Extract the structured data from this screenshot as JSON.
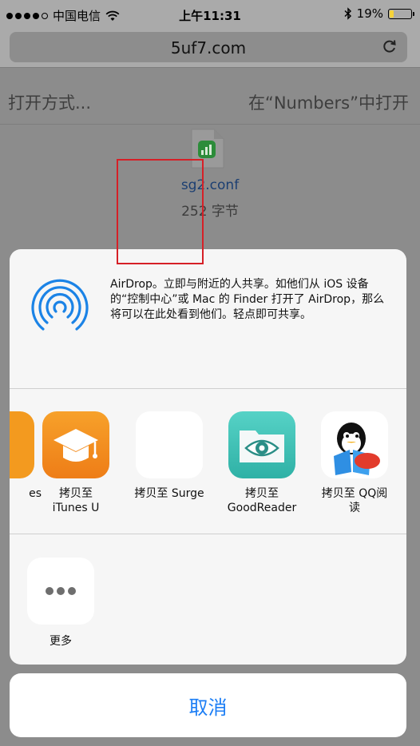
{
  "status_bar": {
    "carrier": "中国电信",
    "time": "上午11:31",
    "battery_percent": "19%",
    "battery_level": 0.19,
    "battery_color": "#f5d33a"
  },
  "browser": {
    "url": "5uf7.com"
  },
  "open_bar": {
    "open_with": "打开方式...",
    "open_in_app": "在“Numbers”中打开"
  },
  "file": {
    "name": "sg2.conf",
    "size": "252 字节"
  },
  "airdrop": {
    "description": "AirDrop。立即与附近的人共享。如他们从 iOS 设备的“控制中心”或 Mac 的 Finder 打开了 AirDrop，那么将可以在此处看到他们。轻点即可共享。",
    "accent": "#1b83e6"
  },
  "apps": [
    {
      "label": "es",
      "icon": "partial-app-icon",
      "color": "#f39a1f"
    },
    {
      "label": "拷贝至\niTunes U",
      "icon": "itunes-u-icon",
      "color": "#f28a1a"
    },
    {
      "label": "拷贝至 Surge",
      "icon": "surge-icon",
      "color": "#7a3cf0"
    },
    {
      "label": "拷贝至\nGoodReader",
      "icon": "goodreader-icon",
      "color": "#45c2b6"
    },
    {
      "label": "拷贝至 QQ阅\n读",
      "icon": "qq-reader-icon",
      "color": "#e23b2c"
    }
  ],
  "more": {
    "label": "更多",
    "icon": "ellipsis-icon"
  },
  "cancel_label": "取消",
  "colors": {
    "highlight": "#d62027",
    "link": "#1c7ef5"
  }
}
